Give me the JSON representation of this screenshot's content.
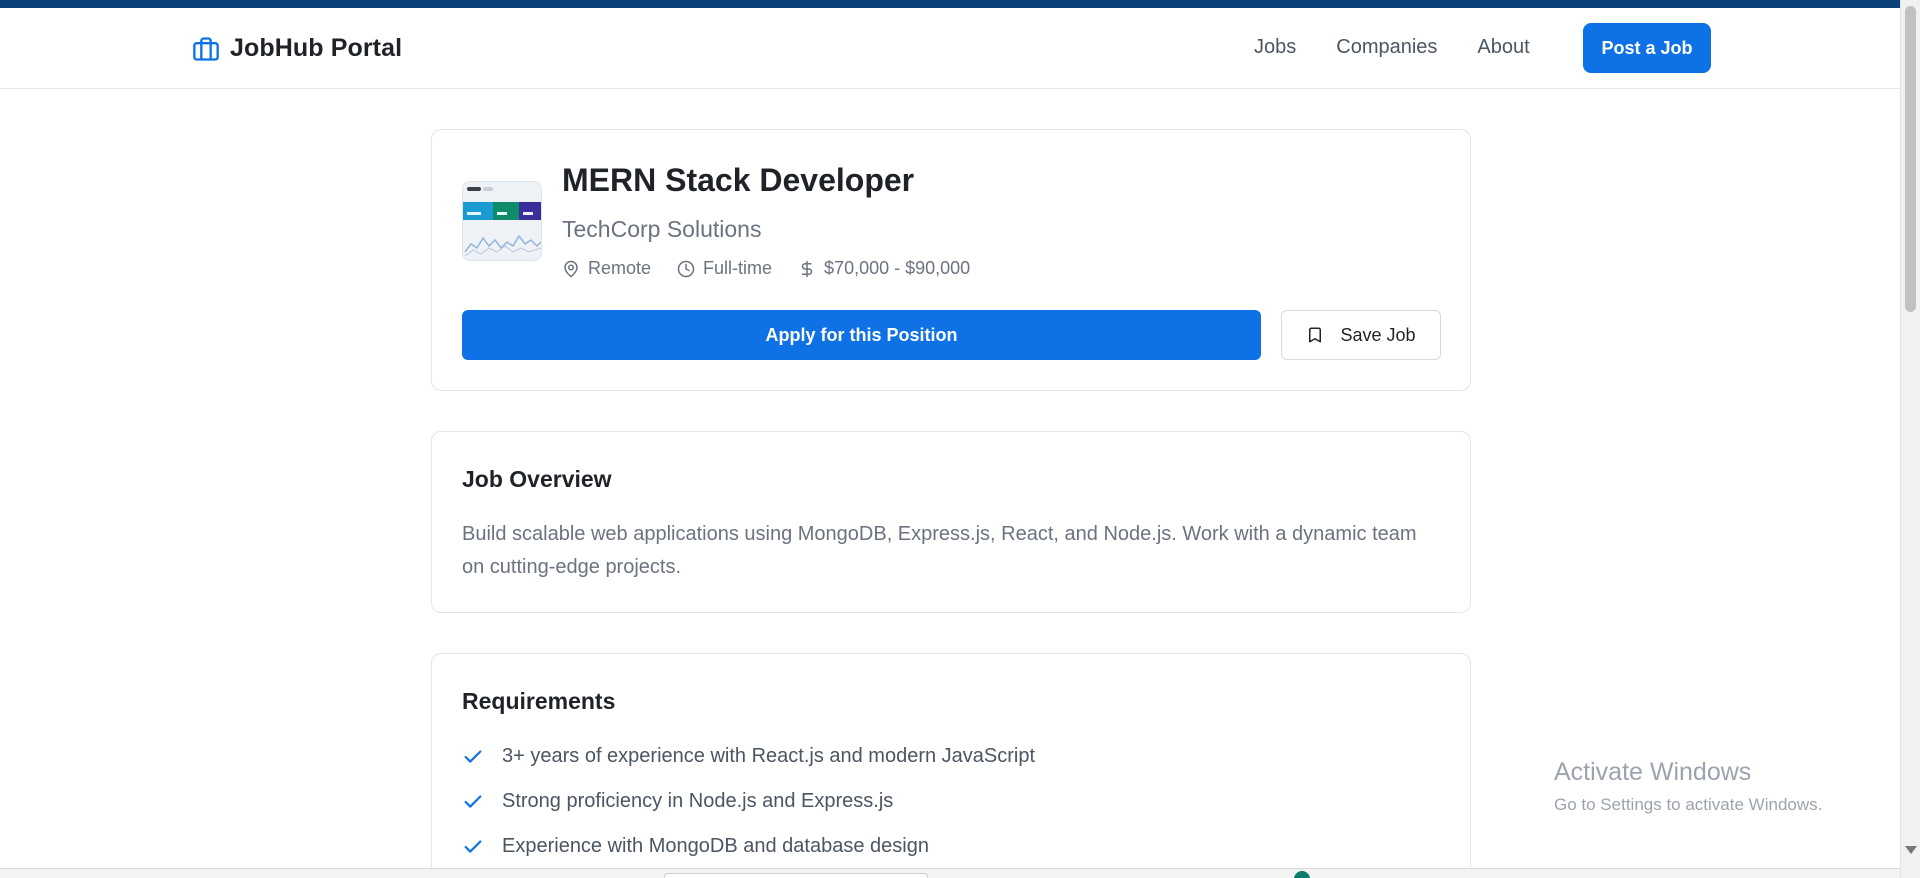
{
  "app": {
    "brand_name": "JobHub Portal",
    "brand_icon": "briefcase-icon",
    "accent_color": "#0e72e6"
  },
  "nav": {
    "links": [
      {
        "label": "Jobs"
      },
      {
        "label": "Companies"
      },
      {
        "label": "About"
      }
    ],
    "cta_label": "Post a Job"
  },
  "job": {
    "title": "MERN Stack Developer",
    "company": "TechCorp Solutions",
    "location": "Remote",
    "type": "Full-time",
    "salary": "$70,000 - $90,000",
    "apply_label": "Apply for this Position",
    "save_label": "Save Job"
  },
  "overview": {
    "heading": "Job Overview",
    "text": "Build scalable web applications using MongoDB, Express.js, React, and Node.js. Work with a dynamic team on cutting-edge projects."
  },
  "requirements": {
    "heading": "Requirements",
    "items": [
      "3+ years of experience with React.js and modern JavaScript",
      "Strong proficiency in Node.js and Express.js",
      "Experience with MongoDB and database design"
    ]
  },
  "watermark": {
    "title": "Activate Windows",
    "subtitle": "Go to Settings to activate Windows."
  }
}
